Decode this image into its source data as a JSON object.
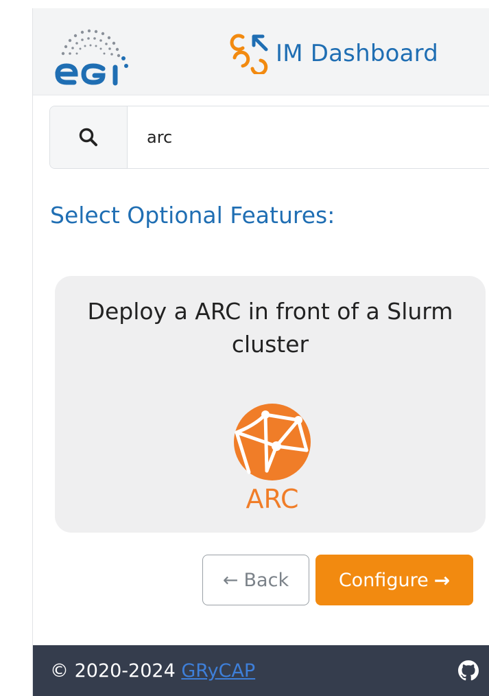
{
  "navbar": {
    "egi_logo_text": "egi",
    "brand_title": "IM Dashboard"
  },
  "search": {
    "value": "arc",
    "placeholder": ""
  },
  "features": {
    "heading": "Select Optional Features:",
    "cards": [
      {
        "title": "Deploy a ARC in front of a Slurm cluster",
        "logo_text": "ARC"
      }
    ]
  },
  "actions": {
    "back_label": "Back",
    "back_arrow": "←",
    "configure_label": "Configure",
    "configure_arrow": "→"
  },
  "footer": {
    "copyright": "© 2020-2024",
    "link_text": "GRyCAP"
  },
  "colors": {
    "brand_blue": "#1f6eb3",
    "accent_orange": "#f28a10",
    "footer_bg": "#353d4d",
    "link_blue": "#3e7fd9"
  },
  "icons": {
    "search": "search-icon",
    "github": "github-icon"
  }
}
